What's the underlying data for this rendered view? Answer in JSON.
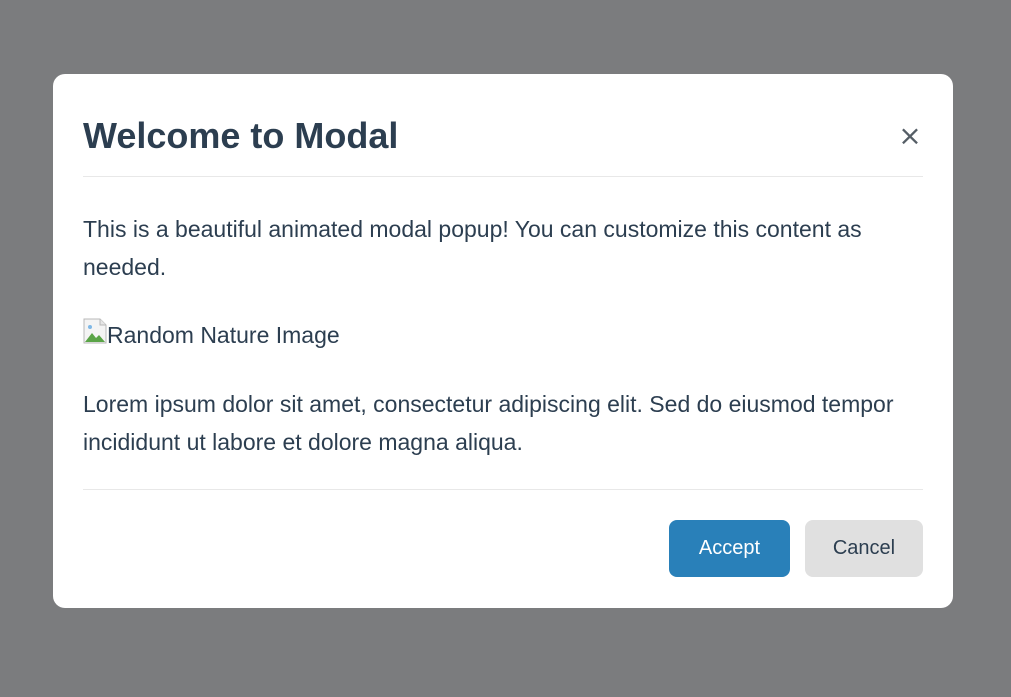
{
  "modal": {
    "title": "Welcome to Modal",
    "close_label": "×",
    "intro_text": "This is a beautiful animated modal popup! You can customize this content as needed.",
    "image_alt": "Random Nature Image",
    "body_text": "Lorem ipsum dolor sit amet, consectetur adipiscing elit. Sed do eiusmod tempor incididunt ut labore et dolore magna aliqua.",
    "accept_label": "Accept",
    "cancel_label": "Cancel"
  },
  "colors": {
    "overlay": "#7b7c7e",
    "modal_background": "#ffffff",
    "text": "#2c3e50",
    "accept_button": "#2980b9",
    "cancel_button": "#e0e0e0",
    "divider": "#e8e8e8"
  },
  "icons": {
    "close": "close-icon",
    "image_placeholder": "broken-image-icon"
  }
}
